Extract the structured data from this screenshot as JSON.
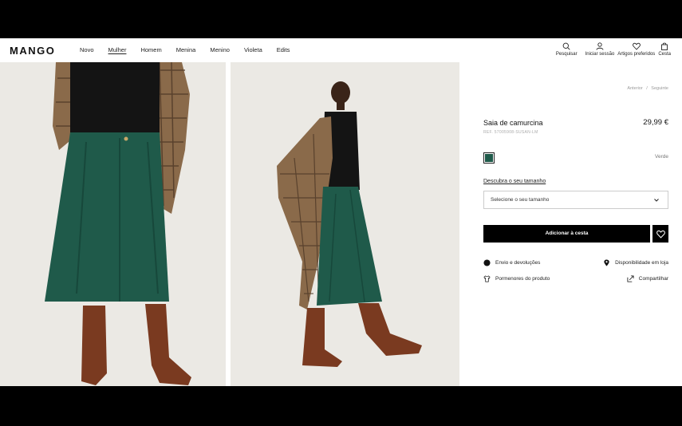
{
  "header": {
    "logo": "MANGO",
    "nav": [
      "Novo",
      "Mulher",
      "Homem",
      "Menina",
      "Menino",
      "Violeta",
      "Edits"
    ],
    "active_nav": "Mulher",
    "tools": {
      "search": "Pesquisar",
      "login": "Iniciar sessão",
      "favorites": "Artigos preferidos",
      "cart": "Cesta"
    }
  },
  "breadcrumb": [
    "Anterior",
    "/",
    "Seguinte"
  ],
  "product": {
    "title": "Saia de camurcina",
    "price": "29,99 €",
    "ref": "REF. 57005908-SUSAN-LM",
    "color_swatch": "#1f5a4a",
    "color_name": "Verde",
    "size_link": "Descubra o seu tamanho",
    "size_placeholder": "Selecione o seu tamanho",
    "add_to_cart": "Adicionar à cesta"
  },
  "info_links": {
    "shipping": "Envio e devoluções",
    "store": "Disponibilidade em loja",
    "details": "Pormenores do produto",
    "share": "Compartilhar"
  },
  "colors": {
    "skirt": "#1f5a4a",
    "background_photo": "#ebe9e4",
    "boots": "#7a3a20",
    "coat": "#8a6a4a"
  }
}
